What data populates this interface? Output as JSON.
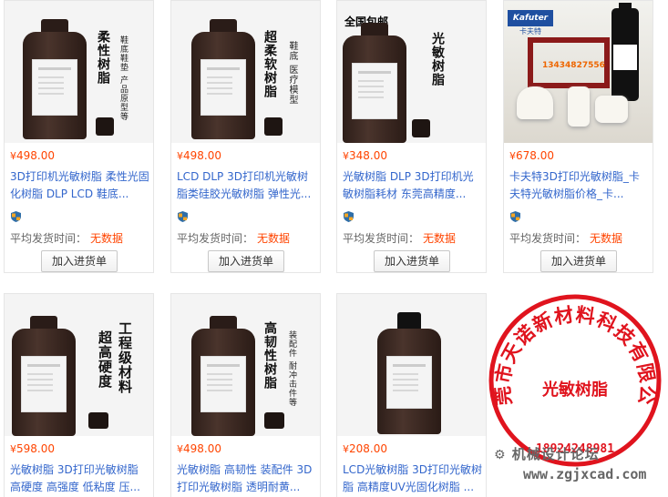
{
  "products": [
    {
      "price": "498.00",
      "title": "3D打印机光敏树脂 柔性光固化树脂 DLP LCD 鞋底...",
      "img_text": "柔性树脂",
      "img_sub": "鞋底鞋垫 产品原型等"
    },
    {
      "price": "498.00",
      "title": "LCD DLP 3D打印机光敏树脂类硅胶光敏树脂 弹性光...",
      "img_text": "超柔软树脂",
      "img_sub": "鞋底 医疗模型"
    },
    {
      "price": "348.00",
      "title": "光敏树脂 DLP 3D打印机光敏树脂耗材 东莞高精度...",
      "img_text": "光敏树脂",
      "img_badge": "全国包邮"
    },
    {
      "price": "678.00",
      "title": "卡夫特3D打印光敏树脂_卡夫特光敏树脂价格_卡...",
      "img_brand": "Kafuter",
      "img_brand_cn": "卡夫特",
      "img_phone": "13434827556"
    },
    {
      "price": "598.00",
      "title": "光敏树脂 3D打印光敏树脂 高硬度 高强度 低粘度 压...",
      "img_text": "工程级材料",
      "img_text2": "超高硬度"
    },
    {
      "price": "498.00",
      "title": "光敏树脂 高韧性 装配件 3D打印光敏树脂 透明耐黄...",
      "img_text": "高韧性树脂",
      "img_sub": "装配件 耐冲击件等"
    },
    {
      "price": "208.00",
      "title": "LCD光敏树脂 3D打印光敏树脂 高精度UV光固化树脂 ..."
    }
  ],
  "labels": {
    "currency": "¥",
    "ship_label": "平均发货时间：",
    "ship_value": "无数据",
    "add_button": "加入进货单"
  },
  "stamp": {
    "company": "东莞市天诺新材料科技有限公司",
    "center": "光敏树脂",
    "number": "18924248981",
    "color": "#e0141e"
  },
  "watermark": {
    "text": "机械设计论坛",
    "url": "www.zgjxcad.com"
  },
  "colors": {
    "price": "#ff4400",
    "link": "#3366cc"
  }
}
